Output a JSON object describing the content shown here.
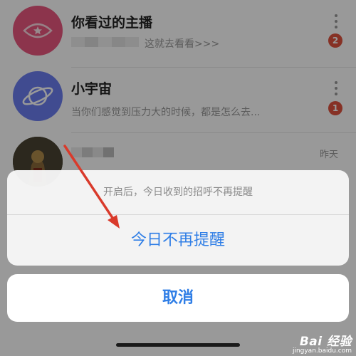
{
  "conversations": [
    {
      "title": "你看过的主播",
      "subtitle": "这就去看看>>>",
      "badge": "2"
    },
    {
      "title": "小宇宙",
      "subtitle": "当你们感觉到压力大的时候，都是怎么去...",
      "badge": "1"
    },
    {
      "title": "",
      "subtitle": "",
      "time": "昨天"
    }
  ],
  "action_sheet": {
    "message": "开启后，今日收到的招呼不再提醒",
    "action_label": "今日不再提醒",
    "cancel_label": "取消"
  },
  "watermark": {
    "logo": "Bai 经验",
    "url": "jingyan.baidu.com"
  },
  "colors": {
    "accent_blue": "#2f7ee6",
    "badge_red": "#e0533f",
    "avatar_pink": "#e9587f",
    "avatar_blue": "#6b7df0",
    "arrow_red": "#d93a2b"
  },
  "icons": {
    "row1": "star-eye-icon",
    "row2": "planet-icon"
  }
}
